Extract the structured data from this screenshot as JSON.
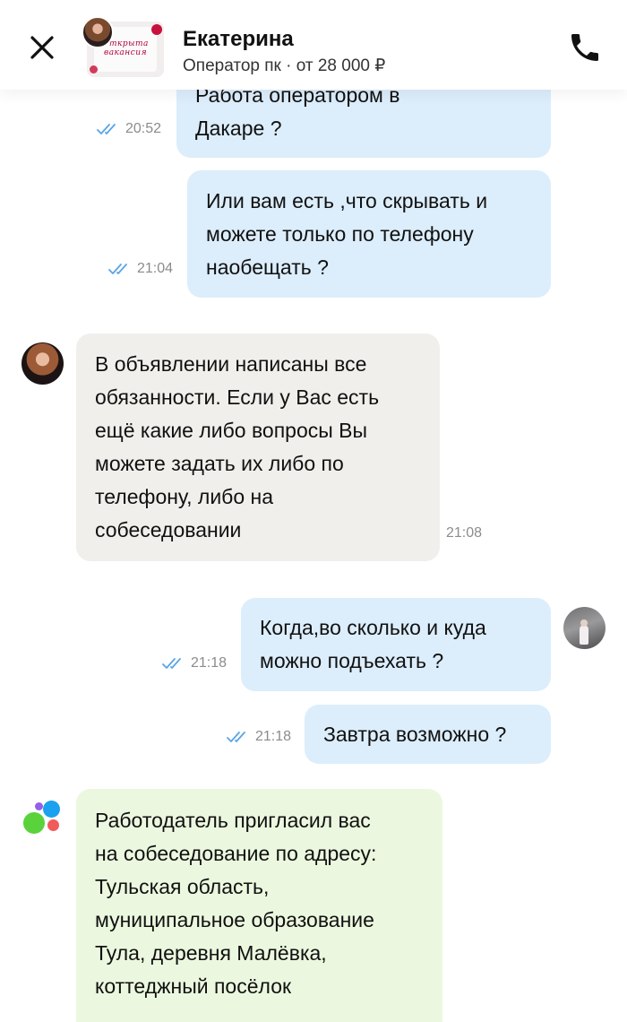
{
  "header": {
    "contact_name": "Екатерина",
    "subtitle": "Оператор пк · от 28 000 ₽",
    "vacancy_image_text": "Открыта вакансия",
    "close_icon": "close-icon",
    "phone_icon": "phone-icon"
  },
  "colors": {
    "outgoing_bubble": "#dcedfb",
    "incoming_bubble": "#f1efec",
    "system_bubble": "#ebf8df",
    "read_ticks": "#5aa5e6",
    "timestamp": "#8c8c8c"
  },
  "messages": [
    {
      "direction": "outgoing",
      "text": "Работа оператором в\nДакаре ?",
      "time": "20:52",
      "status": "read"
    },
    {
      "direction": "outgoing",
      "text": "Или вам есть ,что скрывать и\nможете только по телефону\nнаобещать ?",
      "time": "21:04",
      "status": "read"
    },
    {
      "direction": "incoming",
      "text": "В объявлении написаны все\nобязанности. Если у Вас есть\nещё какие либо вопросы Вы\nможете задать их либо по\nтелефону, либо на\nсобеседовании",
      "time": "21:08"
    },
    {
      "direction": "outgoing",
      "text": "Когда,во сколько и куда\nможно подъехать ?",
      "time": "21:18",
      "status": "read"
    },
    {
      "direction": "outgoing",
      "text": "Завтра возможно ?",
      "time": "21:18",
      "status": "read"
    },
    {
      "direction": "system",
      "text": "Работодатель пригласил вас\nна собеседование по адресу:\nТульская область,\nмуниципальное образование\nТула, деревня Малёвка,\nкоттеджный посёлок"
    }
  ]
}
